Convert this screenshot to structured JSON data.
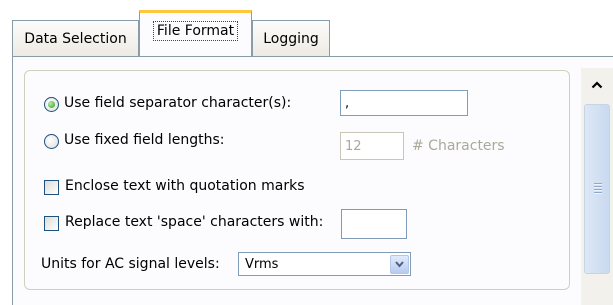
{
  "tabs": [
    {
      "label": "Data Selection",
      "active": false
    },
    {
      "label": "File Format",
      "active": true
    },
    {
      "label": "Logging",
      "active": false
    }
  ],
  "file_format": {
    "separator_option": {
      "label": "Use field separator character(s):",
      "selected": true,
      "value": ","
    },
    "fixed_option": {
      "label": "Use fixed field lengths:",
      "selected": false,
      "value": "12",
      "unit_label": "# Characters"
    },
    "enclose_quotes": {
      "label": "Enclose text with quotation marks",
      "checked": false
    },
    "replace_space": {
      "label": "Replace text 'space' characters with:",
      "checked": false,
      "value": ""
    },
    "units": {
      "label": "Units for AC signal levels:",
      "selected": "Vrms"
    }
  },
  "icons": {
    "scroll_up": "chevron-up-icon",
    "dropdown": "chevron-down-icon"
  },
  "colors": {
    "active_tab_accent": "#ffc83c",
    "radio_dot": "#21a121",
    "border": "#7f9db9"
  }
}
